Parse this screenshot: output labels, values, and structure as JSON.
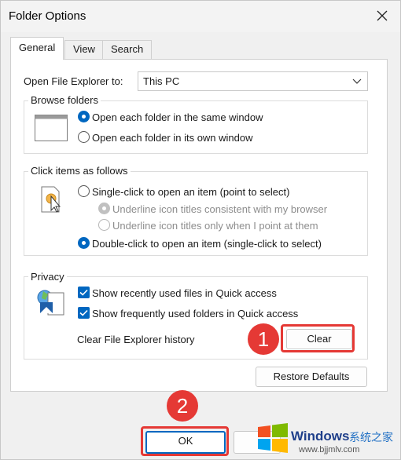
{
  "window": {
    "title": "Folder Options"
  },
  "tabs": [
    "General",
    "View",
    "Search"
  ],
  "general": {
    "open_explorer_label": "Open File Explorer to:",
    "open_explorer_value": "This PC",
    "browse": {
      "title": "Browse folders",
      "options": [
        "Open each folder in the same window",
        "Open each folder in its own window"
      ],
      "selected": 0
    },
    "click": {
      "title": "Click items as follows",
      "single": "Single-click to open an item (point to select)",
      "sub_options": [
        "Underline icon titles consistent with my browser",
        "Underline icon titles only when I point at them"
      ],
      "double": "Double-click to open an item (single-click to select)",
      "selected": "double"
    },
    "privacy": {
      "title": "Privacy",
      "checkboxes": [
        "Show recently used files in Quick access",
        "Show frequently used folders in Quick access"
      ],
      "clear_label": "Clear File Explorer history",
      "clear_button": "Clear"
    },
    "restore_button": "Restore Defaults"
  },
  "footer": {
    "ok": "OK"
  },
  "annotations": {
    "badge1": "1",
    "badge2": "2",
    "color": "#e53935"
  },
  "watermark": {
    "brand": "Windows",
    "site_cn": "系统之家",
    "url": "www.bjjmlv.com"
  }
}
